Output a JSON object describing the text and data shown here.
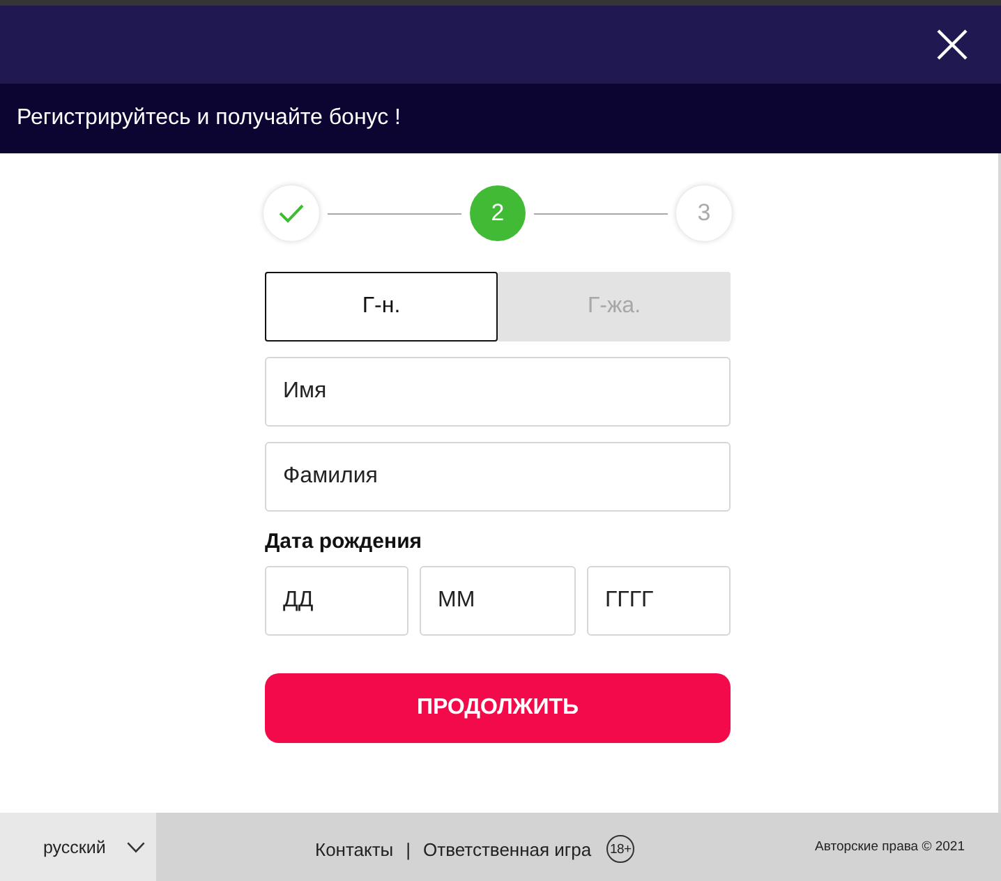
{
  "banner": {
    "text": "Регистрируйтесь и получайте бонус !"
  },
  "stepper": {
    "steps": [
      {
        "completed": true,
        "selected": false
      },
      {
        "label": "2",
        "completed": false,
        "selected": true
      },
      {
        "label": "3",
        "completed": false,
        "selected": false
      }
    ]
  },
  "gender": [
    {
      "label": "Г-н.",
      "selected": true
    },
    {
      "label": "Г-жа.",
      "selected": false
    }
  ],
  "fields": [
    {
      "placeholder": "Имя"
    },
    {
      "placeholder": "Фамилия"
    }
  ],
  "birth_date": {
    "label": "Дата рождения",
    "fields": [
      {
        "placeholder": "ДД"
      },
      {
        "placeholder": "ММ"
      },
      {
        "placeholder": "ГГГГ"
      }
    ]
  },
  "continue_button": {
    "label": "ПРОДОЛЖИТЬ"
  },
  "footer": {
    "language": "русский",
    "links": [
      {
        "label": "Контакты"
      },
      {
        "label": "Ответственная игра"
      }
    ],
    "separator": "|",
    "age_badge": "18+",
    "copyright": "Авторские права © 2021"
  }
}
